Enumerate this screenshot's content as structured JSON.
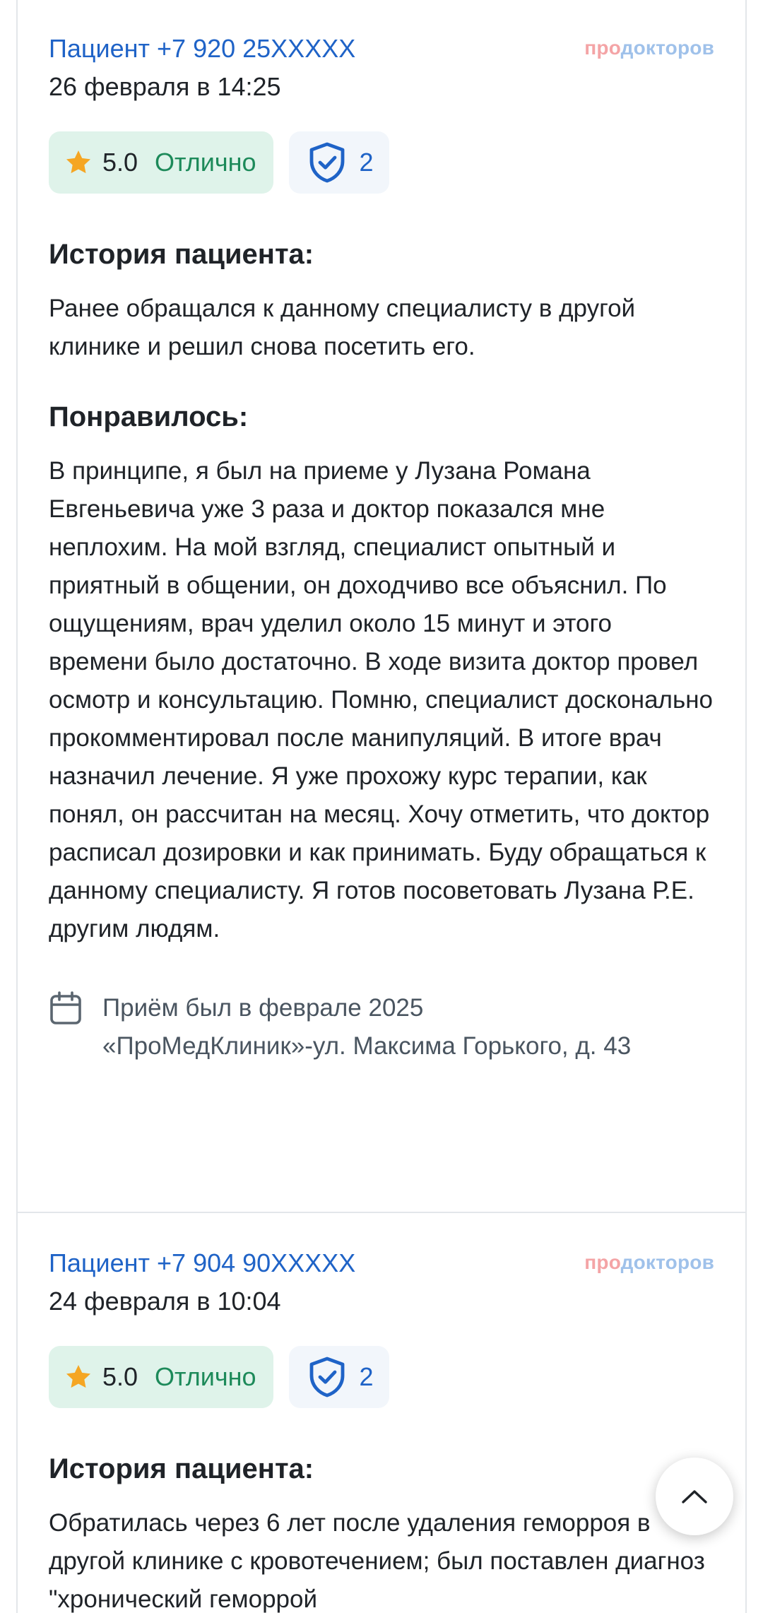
{
  "reviews": [
    {
      "author": "Пациент +7 920 25XXXXX",
      "date": "26 февраля в 14:25",
      "logo": {
        "part1": "про",
        "part2": "докторов"
      },
      "rating": "5.0",
      "rating_word": "Отлично",
      "verified_count": "2",
      "history_title": "История пациента:",
      "history_text": "Ранее обращался к данному специалисту в другой клинике и решил снова посетить его.",
      "liked_title": "Понравилось:",
      "liked_text": "В принципе, я был на приеме у Лузана Романа Евгеньевича уже 3 раза и доктор показался мне неплохим. На мой взгляд, специалист опытный и приятный в общении, он доходчиво все объяснил. По ощущениям, врач уделил около 15 минут и этого времени было достаточно. В ходе визита доктор провел осмотр и консультацию. Помню, специалист досконально прокомментировал после манипуляций. В итоге врач назначил лечение. Я уже прохожу курс терапии, как понял, он рассчитан на месяц. Хочу отметить, что доктор расписал дозировки и как принимать. Буду обращаться к данному специалисту. Я готов посоветовать Лузана Р.Е. другим людям.",
      "visit_date": "Приём был в феврале 2025",
      "visit_place": "«ПроМедКлиник»-ул. Максима Горького, д. 43"
    },
    {
      "author": "Пациент +7 904 90XXXXX",
      "date": "24 февраля в 10:04",
      "logo": {
        "part1": "про",
        "part2": "докторов"
      },
      "rating": "5.0",
      "rating_word": "Отлично",
      "verified_count": "2",
      "history_title": "История пациента:",
      "history_text": "Обратилась через 6 лет после удаления геморроя в другой клинике с кровотечением; был поставлен диагноз \"хронический геморрой"
    }
  ],
  "icons": {
    "star": "star-icon",
    "shield": "shield-check-icon",
    "calendar": "calendar-icon",
    "scroll_top": "chevron-up-icon"
  },
  "colors": {
    "link": "#1f63c7",
    "rating_bg": "#dff3ea",
    "rating_word": "#1d8a5a",
    "star": "#f5a623",
    "verified_bg": "#f2f6fb"
  }
}
